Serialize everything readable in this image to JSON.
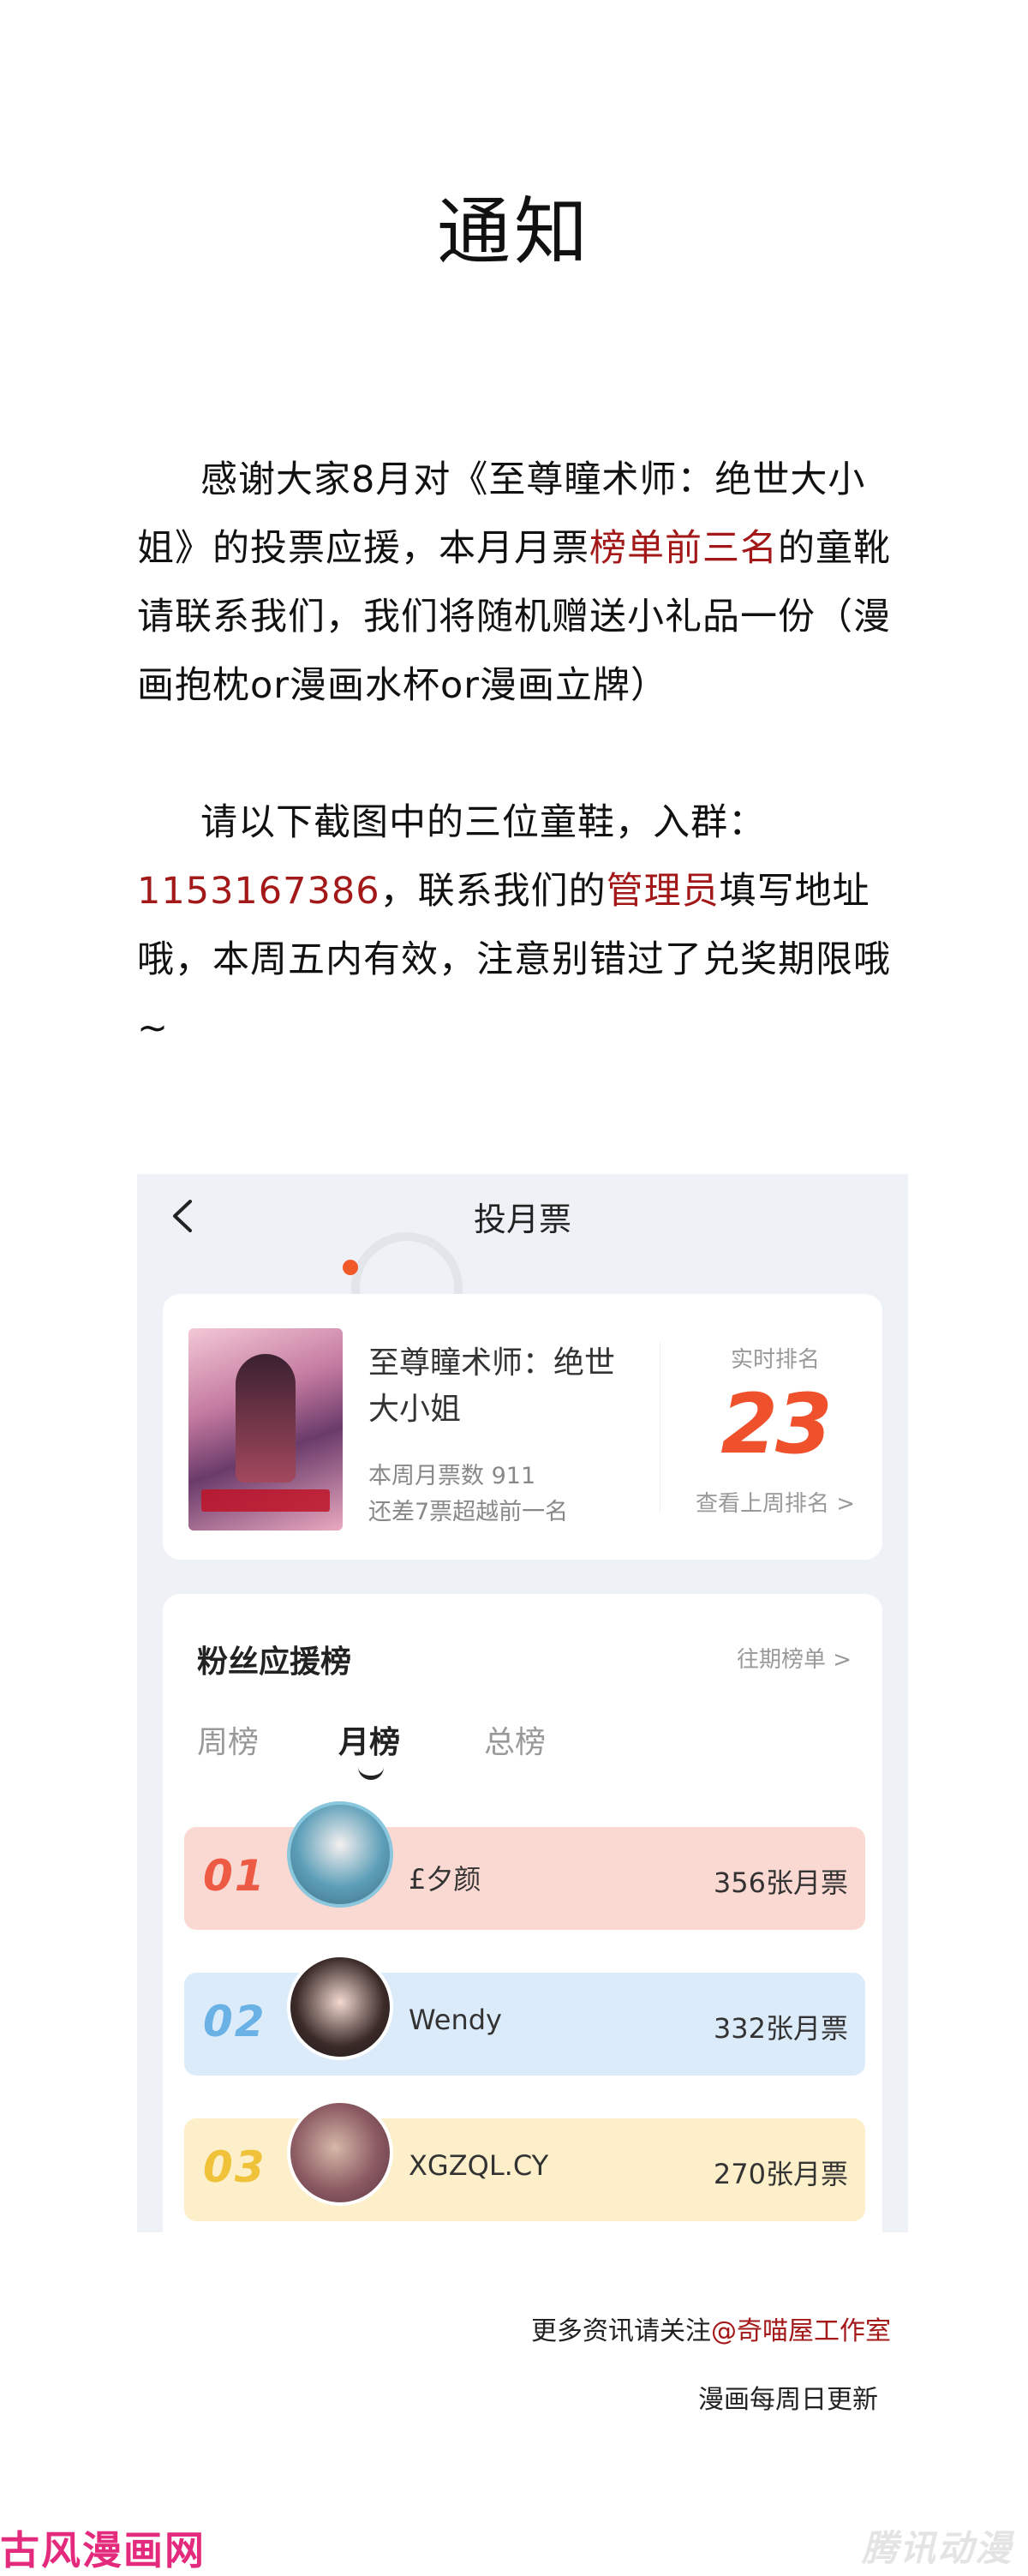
{
  "title": "通知",
  "para1": {
    "text_a": "感谢大家8月对《至尊瞳术师：绝世大小姐》的投票应援，本月月票",
    "text_red": "榜单前三名",
    "text_b": "的童靴请联系我们，我们将随机赠送小礼品一份（漫画抱枕or漫画水杯or漫画立牌）"
  },
  "para2": {
    "text_a": "请以下截图中的三位童鞋，入群：",
    "group_number": "1153167386",
    "text_b": "，联系我们的",
    "text_red": "管理员",
    "text_c": "填写地址哦，本周五内有效，注意别错过了兑奖期限哦~"
  },
  "screenshot": {
    "header_title": "投月票",
    "book": {
      "name": "至尊瞳术师：绝世大小姐",
      "weekly_votes": "本周月票数 911",
      "gap_note": "还差7票超越前一名",
      "rank_label": "实时排名",
      "rank_value": "23",
      "last_week_link": "查看上周排名 >"
    },
    "fans": {
      "title": "粉丝应援榜",
      "past_link": "往期榜单 >",
      "tabs": [
        "周榜",
        "月榜",
        "总榜"
      ],
      "active_tab": "月榜",
      "rows": [
        {
          "rank": "01",
          "name": "£夕颜",
          "votes": "356张月票"
        },
        {
          "rank": "02",
          "name": "Wendy",
          "votes": "332张月票"
        },
        {
          "rank": "03",
          "name": "XGZQL.CY",
          "votes": "270张月票"
        }
      ]
    }
  },
  "footer": {
    "line1_a": "更多资讯请关注",
    "line1_red": "@奇喵屋工作室",
    "line2": "漫画每周日更新"
  },
  "watermarks": {
    "left": "古风漫画网",
    "right": "腾讯动漫"
  },
  "colors": {
    "accent_red": "#a31818",
    "rank_orange": "#f0512d",
    "rank1": "#ee5b45",
    "rank2": "#6ab1e6",
    "rank3": "#f0c23a"
  }
}
